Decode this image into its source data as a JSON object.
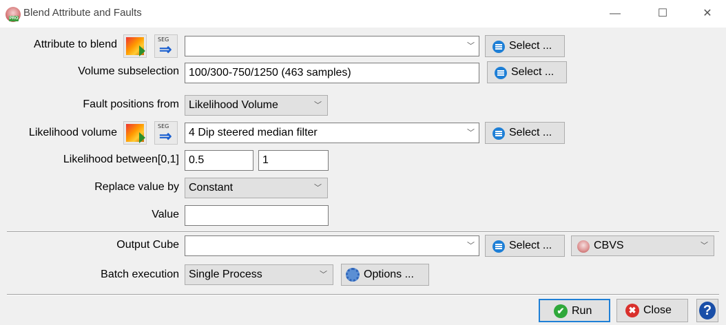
{
  "window": {
    "title": "Blend Attribute and Faults",
    "app_icon_badge": "PRO",
    "minimize": "—",
    "maximize": "☐",
    "close": "✕"
  },
  "attribute_to_blend": {
    "label": "Attribute to blend",
    "value": "",
    "select_label": "Select ...",
    "icons": [
      "attribute-image-icon",
      "seg-arrow-icon"
    ]
  },
  "volume_subselection": {
    "label": "Volume subselection",
    "value": "100/300-750/1250 (463 samples)",
    "select_label": "Select ..."
  },
  "fault_positions": {
    "label": "Fault positions from",
    "value": "Likelihood Volume"
  },
  "likelihood_volume": {
    "label": "Likelihood volume",
    "value": "4 Dip steered median filter",
    "select_label": "Select ..."
  },
  "likelihood_between": {
    "label": "Likelihood between[0,1]",
    "min": "0.5",
    "max": "1"
  },
  "replace_value": {
    "label": "Replace value by",
    "value": "Constant"
  },
  "value_field": {
    "label": "Value",
    "value": ""
  },
  "output_cube": {
    "label": "Output Cube",
    "value": "",
    "select_label": "Select ...",
    "format": "CBVS"
  },
  "batch_execution": {
    "label": "Batch execution",
    "value": "Single Process",
    "options_label": "Options ..."
  },
  "footer": {
    "run_label": "Run",
    "close_label": "Close",
    "help_label": "?"
  },
  "colors": {
    "select_icon": "#1e7fd6",
    "run_icon": "#2fa83a",
    "close_icon": "#d9302c",
    "help_icon": "#1a4fa8"
  }
}
